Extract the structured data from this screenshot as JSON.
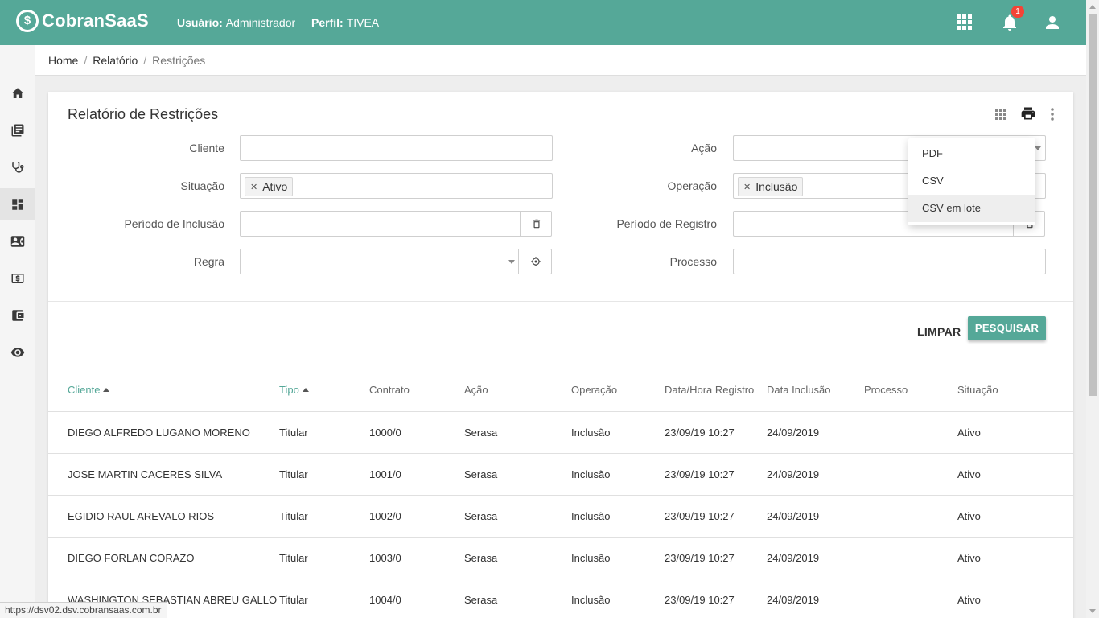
{
  "app": {
    "brand": "CobranSaaS",
    "user_label": "Usuário:",
    "user_value": "Administrador",
    "profile_label": "Perfil:",
    "profile_value": "TIVEA",
    "notification_count": "1",
    "accent_color": "#55a898"
  },
  "breadcrumb": {
    "home": "Home",
    "section": "Relatório",
    "current": "Restrições"
  },
  "page": {
    "title": "Relatório de Restrições"
  },
  "filters": {
    "cliente_label": "Cliente",
    "cliente_value": "",
    "situacao_label": "Situação",
    "situacao_chip": "Ativo",
    "periodo_inclusao_label": "Período de Inclusão",
    "periodo_inclusao_value": "",
    "regra_label": "Regra",
    "regra_value": "",
    "acao_label": "Ação",
    "acao_value": "",
    "operacao_label": "Operação",
    "operacao_chip": "Inclusão",
    "periodo_registro_label": "Período de Registro",
    "periodo_registro_value": "",
    "processo_label": "Processo",
    "processo_value": ""
  },
  "actions": {
    "clear": "LIMPAR",
    "search": "PESQUISAR"
  },
  "export_menu": {
    "items": [
      "PDF",
      "CSV",
      "CSV em lote"
    ],
    "highlighted": "CSV em lote"
  },
  "table": {
    "headers": [
      "Cliente",
      "Tipo",
      "Contrato",
      "Ação",
      "Operação",
      "Data/Hora Registro",
      "Data Inclusão",
      "Processo",
      "Situação"
    ],
    "rows": [
      [
        "DIEGO ALFREDO LUGANO MORENO",
        "Titular",
        "1000/0",
        "Serasa",
        "Inclusão",
        "23/09/19 10:27",
        "24/09/2019",
        "",
        "Ativo"
      ],
      [
        "JOSE MARTIN CACERES SILVA",
        "Titular",
        "1001/0",
        "Serasa",
        "Inclusão",
        "23/09/19 10:27",
        "24/09/2019",
        "",
        "Ativo"
      ],
      [
        "EGIDIO RAUL AREVALO RIOS",
        "Titular",
        "1002/0",
        "Serasa",
        "Inclusão",
        "23/09/19 10:27",
        "24/09/2019",
        "",
        "Ativo"
      ],
      [
        "DIEGO FORLAN CORAZO",
        "Titular",
        "1003/0",
        "Serasa",
        "Inclusão",
        "23/09/19 10:27",
        "24/09/2019",
        "",
        "Ativo"
      ],
      [
        "WASHINGTON SEBASTIAN ABREU GALLO",
        "Titular",
        "1004/0",
        "Serasa",
        "Inclusão",
        "23/09/19 10:27",
        "24/09/2019",
        "",
        "Ativo"
      ]
    ]
  },
  "status_bar": {
    "url": "https://dsv02.dsv.cobransaas.com.br"
  },
  "icons": {
    "nav": [
      "home-icon",
      "book-icon",
      "stethoscope-icon",
      "dashboard-icon",
      "contact-card-icon",
      "money-icon",
      "wallet-icon",
      "eye-icon"
    ]
  }
}
